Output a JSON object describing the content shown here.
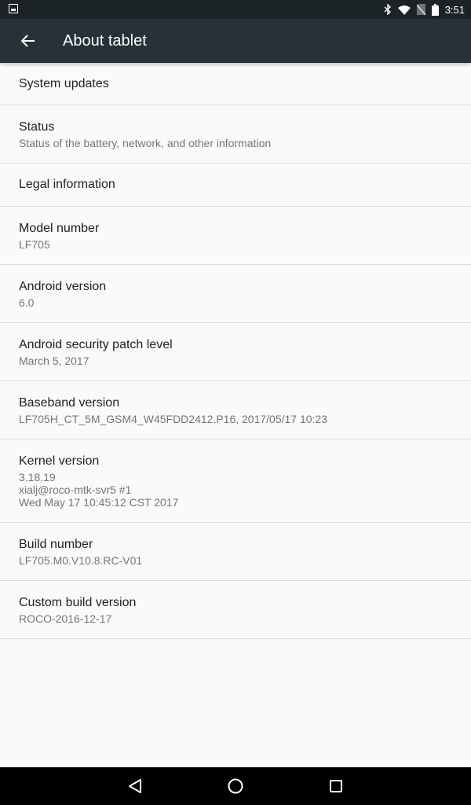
{
  "status_bar": {
    "time": "3:51",
    "icons": [
      "gallery-notification-icon",
      "bluetooth-icon",
      "wifi-icon",
      "no-sim-icon",
      "battery-icon"
    ]
  },
  "toolbar": {
    "title": "About tablet",
    "back_icon": "arrow-back-icon"
  },
  "items": [
    {
      "title": "System updates",
      "lines": []
    },
    {
      "title": "Status",
      "lines": [
        "Status of the battery, network, and other information"
      ]
    },
    {
      "title": "Legal information",
      "lines": []
    },
    {
      "title": "Model number",
      "lines": [
        "LF705"
      ]
    },
    {
      "title": "Android version",
      "lines": [
        "6.0"
      ]
    },
    {
      "title": "Android security patch level",
      "lines": [
        "March 5, 2017"
      ]
    },
    {
      "title": "Baseband version",
      "lines": [
        "LF705H_CT_5M_GSM4_W45FDD2412.P16, 2017/05/17 10:23"
      ]
    },
    {
      "title": "Kernel version",
      "lines": [
        "3.18.19",
        "xialj@roco-mtk-svr5 #1",
        "Wed May 17 10:45:12 CST 2017"
      ]
    },
    {
      "title": "Build number",
      "lines": [
        "LF705.M0.V10.8.RC-V01"
      ]
    },
    {
      "title": "Custom build version",
      "lines": [
        "ROCO-2016-12-17"
      ]
    }
  ],
  "nav_bar": {
    "buttons": [
      "back",
      "home",
      "recents"
    ]
  }
}
